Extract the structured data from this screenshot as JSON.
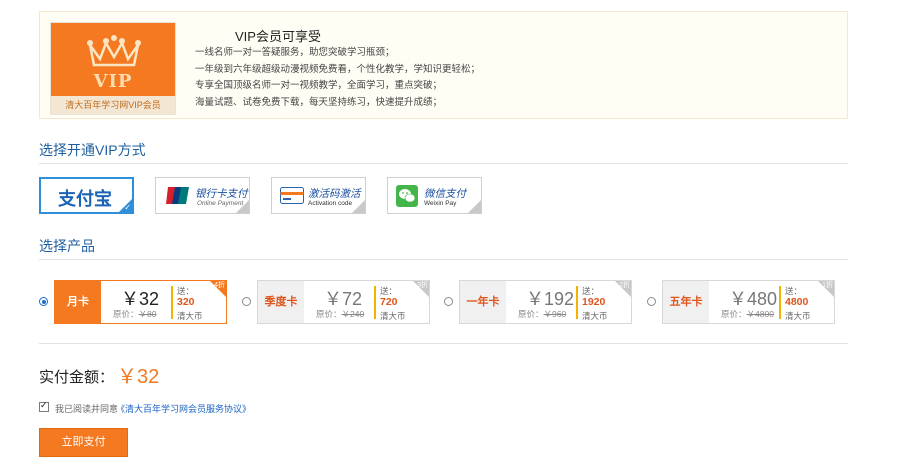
{
  "vip_banner": {
    "badge_text": "VIP",
    "badge_caption": "清大百年学习网VIP会员",
    "title": "VIP会员可享受",
    "benefits": [
      "一线名师一对一答疑服务，助您突破学习瓶颈；",
      "一年级到六年级超级动漫视频免费看，个性化教学，学知识更轻松；",
      "专享全国顶级名师一对一视频教学，全面学习，重点突破；",
      "海量试题、试卷免费下载，每天坚持练习，快速提升成绩；"
    ]
  },
  "payment_section": {
    "title": "选择开通VIP方式",
    "methods": [
      {
        "label": "支付宝",
        "sub": "",
        "selected": true,
        "icon": "alipay-logo"
      },
      {
        "label": "银行卡支付",
        "sub": "Online Payment",
        "selected": false,
        "icon": "unionpay-logo"
      },
      {
        "label": "激活码激活",
        "sub": "Activation code",
        "selected": false,
        "icon": "card-icon"
      },
      {
        "label": "微信支付",
        "sub": "Weixin Pay",
        "selected": false,
        "icon": "wechat-icon"
      }
    ],
    "unionpay_text": "UnionPay 银联"
  },
  "product_section": {
    "title": "选择产品",
    "products": [
      {
        "name": "月卡",
        "price": "￥32",
        "orig_label": "原价：",
        "orig_price": "￥80",
        "bonus_label": "送：",
        "bonus": "320",
        "coin": "清大币",
        "discount": "4折",
        "selected": true
      },
      {
        "name": "季度卡",
        "price": "￥72",
        "orig_label": "原价：",
        "orig_price": "￥240",
        "bonus_label": "送：",
        "bonus": "720",
        "coin": "清大币",
        "discount": "3折",
        "selected": false
      },
      {
        "name": "一年卡",
        "price": "￥192",
        "orig_label": "原价：",
        "orig_price": "￥960",
        "bonus_label": "送：",
        "bonus": "1920",
        "coin": "清大币",
        "discount": "2折",
        "selected": false
      },
      {
        "name": "五年卡",
        "price": "￥480",
        "orig_label": "原价：",
        "orig_price": "￥4800",
        "bonus_label": "送：",
        "bonus": "4800",
        "coin": "清大币",
        "discount": "1折",
        "selected": false
      }
    ]
  },
  "total": {
    "label": "实付金额：",
    "value": "￥32"
  },
  "agreement": {
    "checked": true,
    "text": "我已阅读并同意",
    "link": "《清大百年学习网会员服务协议》"
  },
  "pay_button": {
    "label": "立即支付"
  },
  "colors": {
    "accent": "#f47920",
    "link": "#1a62c4",
    "section_title": "#1f5f9f",
    "selected_border": "#2f8fd8"
  }
}
